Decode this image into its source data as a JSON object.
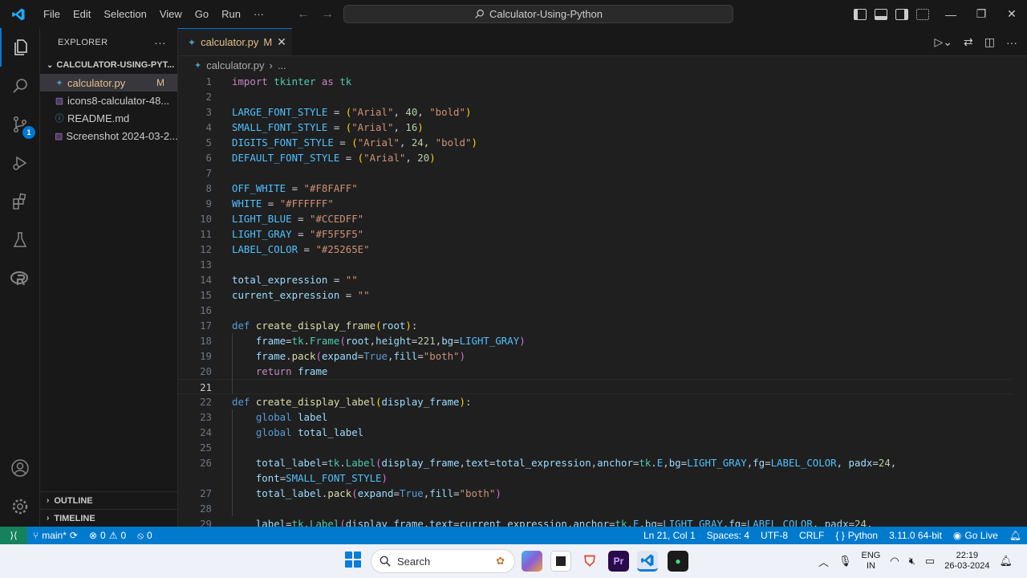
{
  "titlebar": {
    "menu": [
      "File",
      "Edit",
      "Selection",
      "View",
      "Go",
      "Run",
      "···"
    ],
    "search": "Calculator-Using-Python"
  },
  "explorer": {
    "title": "EXPLORER",
    "folder": "CALCULATOR-USING-PYT...",
    "files": [
      {
        "name": "calculator.py",
        "status": "M",
        "icon": "python-icon",
        "selected": true
      },
      {
        "name": "icons8-calculator-48...",
        "status": "",
        "icon": "image-icon"
      },
      {
        "name": "README.md",
        "status": "",
        "icon": "info-icon"
      },
      {
        "name": "Screenshot 2024-03-2...",
        "status": "",
        "icon": "image-icon"
      }
    ],
    "outline": "OUTLINE",
    "timeline": "TIMELINE"
  },
  "activity": {
    "scm_badge": "1"
  },
  "editor": {
    "tab": {
      "name": "calculator.py",
      "status": "M"
    },
    "breadcrumb": {
      "file": "calculator.py",
      "rest": "..."
    },
    "current_line": 21,
    "lines": [
      {
        "n": "1",
        "tokens": [
          [
            "kw",
            "import"
          ],
          [
            "plain",
            " "
          ],
          [
            "cls",
            "tkinter"
          ],
          [
            "plain",
            " "
          ],
          [
            "kw",
            "as"
          ],
          [
            "plain",
            " "
          ],
          [
            "cls",
            "tk"
          ]
        ]
      },
      {
        "n": "2",
        "tokens": []
      },
      {
        "n": "3",
        "tokens": [
          [
            "const",
            "LARGE_FONT_STYLE"
          ],
          [
            "plain",
            " = "
          ],
          [
            "par",
            "("
          ],
          [
            "str",
            "\"Arial\""
          ],
          [
            "plain",
            ", "
          ],
          [
            "num",
            "40"
          ],
          [
            "plain",
            ", "
          ],
          [
            "str",
            "\"bold\""
          ],
          [
            "par",
            ")"
          ]
        ]
      },
      {
        "n": "4",
        "tokens": [
          [
            "const",
            "SMALL_FONT_STYLE"
          ],
          [
            "plain",
            " = "
          ],
          [
            "par",
            "("
          ],
          [
            "str",
            "\"Arial\""
          ],
          [
            "plain",
            ", "
          ],
          [
            "num",
            "16"
          ],
          [
            "par",
            ")"
          ]
        ]
      },
      {
        "n": "5",
        "tokens": [
          [
            "const",
            "DIGITS_FONT_STYLE"
          ],
          [
            "plain",
            " = "
          ],
          [
            "par",
            "("
          ],
          [
            "str",
            "\"Arial\""
          ],
          [
            "plain",
            ", "
          ],
          [
            "num",
            "24"
          ],
          [
            "plain",
            ", "
          ],
          [
            "str",
            "\"bold\""
          ],
          [
            "par",
            ")"
          ]
        ]
      },
      {
        "n": "6",
        "tokens": [
          [
            "const",
            "DEFAULT_FONT_STYLE"
          ],
          [
            "plain",
            " = "
          ],
          [
            "par",
            "("
          ],
          [
            "str",
            "\"Arial\""
          ],
          [
            "plain",
            ", "
          ],
          [
            "num",
            "20"
          ],
          [
            "par",
            ")"
          ]
        ]
      },
      {
        "n": "7",
        "tokens": []
      },
      {
        "n": "8",
        "tokens": [
          [
            "const",
            "OFF_WHITE"
          ],
          [
            "plain",
            " = "
          ],
          [
            "str",
            "\"#F8FAFF\""
          ]
        ]
      },
      {
        "n": "9",
        "tokens": [
          [
            "const",
            "WHITE"
          ],
          [
            "plain",
            " = "
          ],
          [
            "str",
            "\"#FFFFFF\""
          ]
        ]
      },
      {
        "n": "10",
        "tokens": [
          [
            "const",
            "LIGHT_BLUE"
          ],
          [
            "plain",
            " = "
          ],
          [
            "str",
            "\"#CCEDFF\""
          ]
        ]
      },
      {
        "n": "11",
        "tokens": [
          [
            "const",
            "LIGHT_GRAY"
          ],
          [
            "plain",
            " = "
          ],
          [
            "str",
            "\"#F5F5F5\""
          ]
        ]
      },
      {
        "n": "12",
        "tokens": [
          [
            "const",
            "LABEL_COLOR"
          ],
          [
            "plain",
            " = "
          ],
          [
            "str",
            "\"#25265E\""
          ]
        ]
      },
      {
        "n": "13",
        "tokens": []
      },
      {
        "n": "14",
        "tokens": [
          [
            "var",
            "total_expression"
          ],
          [
            "plain",
            " = "
          ],
          [
            "str",
            "\"\""
          ]
        ]
      },
      {
        "n": "15",
        "tokens": [
          [
            "var",
            "current_expression"
          ],
          [
            "plain",
            " = "
          ],
          [
            "str",
            "\"\""
          ]
        ]
      },
      {
        "n": "16",
        "tokens": []
      },
      {
        "n": "17",
        "tokens": [
          [
            "def",
            "def"
          ],
          [
            "plain",
            " "
          ],
          [
            "fn",
            "create_display_frame"
          ],
          [
            "par",
            "("
          ],
          [
            "param",
            "root"
          ],
          [
            "par",
            ")"
          ],
          [
            "plain",
            ":"
          ]
        ]
      },
      {
        "n": "18",
        "tokens": [
          [
            "plain",
            "    "
          ],
          [
            "var",
            "frame"
          ],
          [
            "plain",
            "="
          ],
          [
            "cls",
            "tk"
          ],
          [
            "plain",
            "."
          ],
          [
            "cls",
            "Frame"
          ],
          [
            "par2",
            "("
          ],
          [
            "var",
            "root"
          ],
          [
            "plain",
            ","
          ],
          [
            "var",
            "height"
          ],
          [
            "plain",
            "="
          ],
          [
            "num",
            "221"
          ],
          [
            "plain",
            ","
          ],
          [
            "var",
            "bg"
          ],
          [
            "plain",
            "="
          ],
          [
            "const",
            "LIGHT_GRAY"
          ],
          [
            "par2",
            ")"
          ]
        ]
      },
      {
        "n": "19",
        "tokens": [
          [
            "plain",
            "    "
          ],
          [
            "var",
            "frame"
          ],
          [
            "plain",
            "."
          ],
          [
            "fn",
            "pack"
          ],
          [
            "par2",
            "("
          ],
          [
            "var",
            "expand"
          ],
          [
            "plain",
            "="
          ],
          [
            "def",
            "True"
          ],
          [
            "plain",
            ","
          ],
          [
            "var",
            "fill"
          ],
          [
            "plain",
            "="
          ],
          [
            "str",
            "\"both\""
          ],
          [
            "par2",
            ")"
          ]
        ]
      },
      {
        "n": "20",
        "tokens": [
          [
            "plain",
            "    "
          ],
          [
            "kw",
            "return"
          ],
          [
            "plain",
            " "
          ],
          [
            "var",
            "frame"
          ]
        ]
      },
      {
        "n": "21",
        "tokens": []
      },
      {
        "n": "22",
        "tokens": [
          [
            "def",
            "def"
          ],
          [
            "plain",
            " "
          ],
          [
            "fn",
            "create_display_label"
          ],
          [
            "par",
            "("
          ],
          [
            "param",
            "display_frame"
          ],
          [
            "par",
            ")"
          ],
          [
            "plain",
            ":"
          ]
        ]
      },
      {
        "n": "23",
        "tokens": [
          [
            "plain",
            "    "
          ],
          [
            "def",
            "global"
          ],
          [
            "plain",
            " "
          ],
          [
            "var",
            "label"
          ]
        ]
      },
      {
        "n": "24",
        "tokens": [
          [
            "plain",
            "    "
          ],
          [
            "def",
            "global"
          ],
          [
            "plain",
            " "
          ],
          [
            "var",
            "total_label"
          ]
        ]
      },
      {
        "n": "25",
        "tokens": []
      },
      {
        "n": "26",
        "tokens": [
          [
            "plain",
            "    "
          ],
          [
            "var",
            "total_label"
          ],
          [
            "plain",
            "="
          ],
          [
            "cls",
            "tk"
          ],
          [
            "plain",
            "."
          ],
          [
            "cls",
            "Label"
          ],
          [
            "par2",
            "("
          ],
          [
            "var",
            "display_frame"
          ],
          [
            "plain",
            ","
          ],
          [
            "var",
            "text"
          ],
          [
            "plain",
            "="
          ],
          [
            "var",
            "total_expression"
          ],
          [
            "plain",
            ","
          ],
          [
            "var",
            "anchor"
          ],
          [
            "plain",
            "="
          ],
          [
            "cls",
            "tk"
          ],
          [
            "plain",
            "."
          ],
          [
            "const",
            "E"
          ],
          [
            "plain",
            ","
          ],
          [
            "var",
            "bg"
          ],
          [
            "plain",
            "="
          ],
          [
            "const",
            "LIGHT_GRAY"
          ],
          [
            "plain",
            ","
          ],
          [
            "var",
            "fg"
          ],
          [
            "plain",
            "="
          ],
          [
            "const",
            "LABEL_COLOR"
          ],
          [
            "plain",
            ", "
          ],
          [
            "var",
            "padx"
          ],
          [
            "plain",
            "="
          ],
          [
            "num",
            "24"
          ],
          [
            "plain",
            ","
          ]
        ]
      },
      {
        "n": "",
        "tokens": [
          [
            "plain",
            "    "
          ],
          [
            "var",
            "font"
          ],
          [
            "plain",
            "="
          ],
          [
            "const",
            "SMALL_FONT_STYLE"
          ],
          [
            "par2",
            ")"
          ]
        ]
      },
      {
        "n": "27",
        "tokens": [
          [
            "plain",
            "    "
          ],
          [
            "var",
            "total_label"
          ],
          [
            "plain",
            "."
          ],
          [
            "fn",
            "pack"
          ],
          [
            "par2",
            "("
          ],
          [
            "var",
            "expand"
          ],
          [
            "plain",
            "="
          ],
          [
            "def",
            "True"
          ],
          [
            "plain",
            ","
          ],
          [
            "var",
            "fill"
          ],
          [
            "plain",
            "="
          ],
          [
            "str",
            "\"both\""
          ],
          [
            "par2",
            ")"
          ]
        ]
      },
      {
        "n": "28",
        "tokens": []
      },
      {
        "n": "29",
        "tokens": [
          [
            "plain",
            "    "
          ],
          [
            "var",
            "label"
          ],
          [
            "plain",
            "="
          ],
          [
            "cls",
            "tk"
          ],
          [
            "plain",
            "."
          ],
          [
            "cls",
            "Label"
          ],
          [
            "par2",
            "("
          ],
          [
            "var",
            "display_frame"
          ],
          [
            "plain",
            ","
          ],
          [
            "var",
            "text"
          ],
          [
            "plain",
            "="
          ],
          [
            "var",
            "current_expression"
          ],
          [
            "plain",
            ","
          ],
          [
            "var",
            "anchor"
          ],
          [
            "plain",
            "="
          ],
          [
            "cls",
            "tk"
          ],
          [
            "plain",
            "."
          ],
          [
            "const",
            "E"
          ],
          [
            "plain",
            ","
          ],
          [
            "var",
            "bg"
          ],
          [
            "plain",
            "="
          ],
          [
            "const",
            "LIGHT_GRAY"
          ],
          [
            "plain",
            ","
          ],
          [
            "var",
            "fg"
          ],
          [
            "plain",
            "="
          ],
          [
            "const",
            "LABEL_COLOR"
          ],
          [
            "plain",
            ", "
          ],
          [
            "var",
            "padx"
          ],
          [
            "plain",
            "="
          ],
          [
            "num",
            "24"
          ],
          [
            "plain",
            ","
          ]
        ]
      }
    ]
  },
  "status": {
    "branch": "main*",
    "errors": "0",
    "warnings": "0",
    "ports": "0",
    "position": "Ln 21, Col 1",
    "spaces": "Spaces: 4",
    "encoding": "UTF-8",
    "eol": "CRLF",
    "language": "Python",
    "interpreter": "3.11.0 64-bit",
    "golive": "Go Live"
  },
  "taskbar": {
    "search": "Search",
    "lang_top": "ENG",
    "lang_bottom": "IN",
    "time": "22:19",
    "date": "26-03-2024"
  },
  "colors": {
    "accent": "#007acc",
    "remote": "#16825d",
    "modified": "#e2c08d"
  }
}
